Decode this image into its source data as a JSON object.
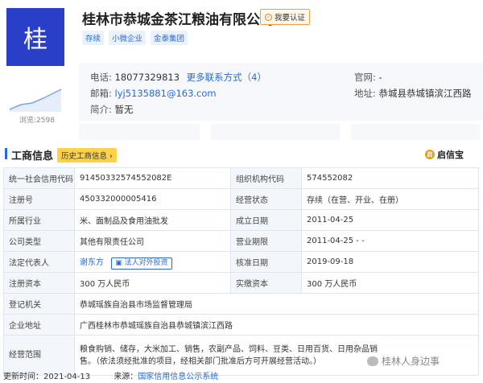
{
  "header": {
    "logo_char": "桂",
    "views": "浏览:2598",
    "company_name": "桂林市恭城金茶江粮油有限公司",
    "verify_label": "我要认证",
    "tags": [
      "存续",
      "小微企业",
      "金泰集团"
    ]
  },
  "contact": {
    "phone_label": "电话:",
    "phone": "18077329813",
    "more_contacts": "更多联系方式（4）",
    "email_label": "邮箱:",
    "email": "lyj5135881@163.com",
    "intro_label": "简介:",
    "intro": "暂无",
    "website_label": "官网:",
    "website": "-",
    "address_label": "地址:",
    "address": "恭城县恭城镇滨江西路"
  },
  "section": {
    "title": "工商信息",
    "history_button": "历史工商信息",
    "provider": "启信宝"
  },
  "business_info": {
    "credit_code_label": "统一社会信用代码",
    "credit_code": "91450332574552082E",
    "org_code_label": "组织机构代码",
    "org_code": "574552082",
    "reg_no_label": "注册号",
    "reg_no": "450332000005416",
    "status_label": "经营状态",
    "status": "存续（在营、开业、在册）",
    "industry_label": "所属行业",
    "industry": "米、面制品及食用油批发",
    "founded_label": "成立日期",
    "founded": "2011-04-25",
    "company_type_label": "公司类型",
    "company_type": "其他有限责任公司",
    "term_label": "营业期限",
    "term": "2011-04-25 - -",
    "legal_rep_label": "法定代表人",
    "legal_rep": "谢东方",
    "legal_rep_invest": "法人对外投资",
    "approval_date_label": "核准日期",
    "approval_date": "2019-09-18",
    "reg_capital_label": "注册资本",
    "reg_capital": "300 万人民币",
    "paid_capital_label": "实缴资本",
    "paid_capital": "300 万人民币",
    "authority_label": "登记机关",
    "authority": "恭城瑶族自治县市场监督管理局",
    "company_address_label": "企业地址",
    "company_address": "广西桂林市恭城瑶族自治县恭城镇滨江西路",
    "scope_label": "经营范围",
    "scope": "粮食购销、储存，大米加工、销售，农副产品、饲料、豆类、日用百货、日用杂品销售。（依法须经批准的项目，经相关部门批准后方可开展经营活动。）"
  },
  "watermark": "桂林人身边事",
  "footer": {
    "updated_label": "更新时间：",
    "updated": "2021-04-13",
    "source_label": "来源：",
    "source": "国家信用信息公示系统"
  }
}
